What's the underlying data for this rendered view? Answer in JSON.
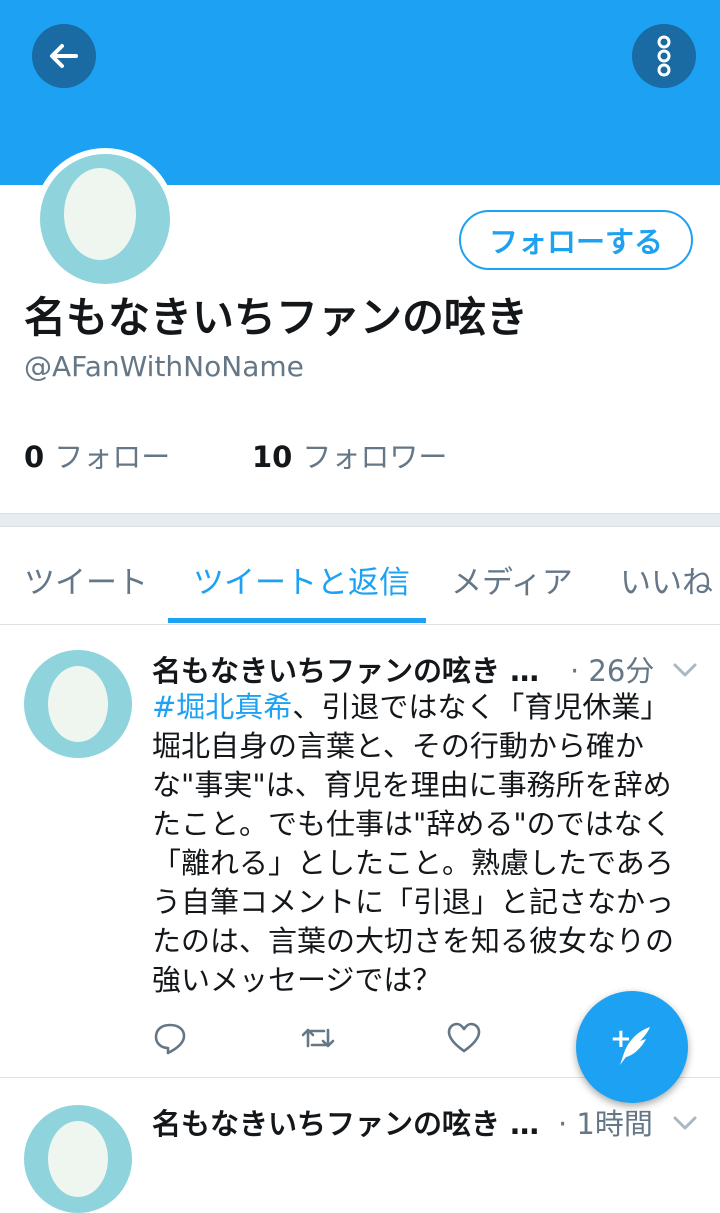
{
  "header": {
    "back_icon": "arrow-left-icon",
    "more_icon": "vertical-dots-icon",
    "banner_color": "#1da1f2"
  },
  "profile": {
    "follow_button": "フォローする",
    "display_name": "名もなきいちファンの呟き",
    "handle": "@AFanWithNoName",
    "following_count": "0",
    "following_label": "フォロー",
    "followers_count": "10",
    "followers_label": "フォロワー"
  },
  "tabs": [
    {
      "label": "ツイート",
      "active": false
    },
    {
      "label": "ツイートと返信",
      "active": true
    },
    {
      "label": "メディア",
      "active": false
    },
    {
      "label": "いいね",
      "active": false
    }
  ],
  "tweets": [
    {
      "name": "名もなきいちファンの呟き …",
      "time": "· 26分",
      "hashtag": "#堀北真希",
      "lines": [
        "、引退ではなく「育児休業」",
        "堀北自身の言葉と、その行動から確か",
        "な\"事実\"は、育児を理由に事務所を辞め",
        "たこと。でも仕事は\"辞める\"のではなく",
        "「離れる」としたこと。熟慮したであろ",
        "う自筆コメントに「引退」と記さなかっ",
        "たのは、言葉の大切さを知る彼女なりの",
        "強いメッセージでは？"
      ]
    },
    {
      "name": "名もなきいちファンの呟き …",
      "time": "· 1時間"
    }
  ],
  "fab": {
    "icon": "compose-tweet-icon",
    "plus": "+"
  }
}
